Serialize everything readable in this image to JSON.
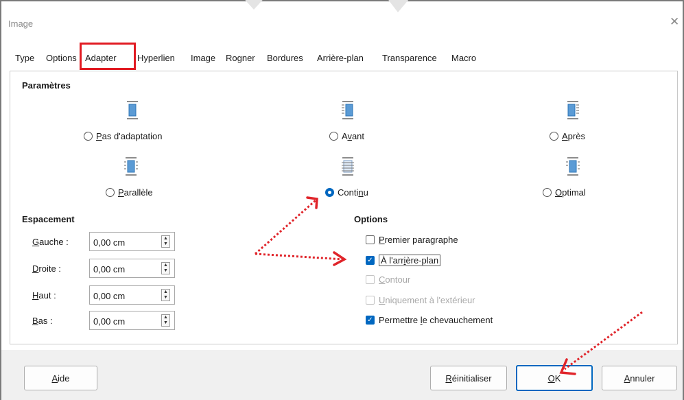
{
  "window": {
    "title": "Image",
    "close_glyph": "✕"
  },
  "tabs": [
    "Type",
    "Options",
    "Adapter",
    "Hyperlien",
    "Image",
    "Rogner",
    "Bordures",
    "Arrière-plan",
    "Transparence",
    "Macro"
  ],
  "active_tab": "Adapter",
  "parametres": {
    "title": "Paramètres",
    "options": [
      {
        "mnemonic": "P",
        "rest": "as d'adaptation",
        "checked": false,
        "icon": "wrap-none-icon"
      },
      {
        "mnemonic": "",
        "rest": "Avant",
        "pre": "A",
        "mn2": "v",
        "post": "ant",
        "checked": false,
        "icon": "wrap-before-icon"
      },
      {
        "mnemonic": "A",
        "rest": "près",
        "checked": false,
        "icon": "wrap-after-icon"
      },
      {
        "mnemonic": "P",
        "rest": "arallèle",
        "checked": false,
        "icon": "wrap-parallel-icon"
      },
      {
        "pre": "Conti",
        "mn2": "n",
        "post": "u",
        "checked": true,
        "icon": "wrap-through-icon"
      },
      {
        "mnemonic": "O",
        "rest": "ptimal",
        "checked": false,
        "icon": "wrap-optimal-icon"
      }
    ]
  },
  "espacement": {
    "title": "Espacement",
    "fields": [
      {
        "mnemonic": "G",
        "rest": "auche :",
        "value": "0,00 cm"
      },
      {
        "mnemonic": "D",
        "rest": "roite :",
        "value": "0,00 cm"
      },
      {
        "mnemonic": "H",
        "rest": "aut :",
        "value": "0,00 cm"
      },
      {
        "mnemonic": "B",
        "rest": "as :",
        "value": "0,00 cm"
      }
    ]
  },
  "options": {
    "title": "Options",
    "items": [
      {
        "mnemonic": "P",
        "rest": "remier paragraphe",
        "checked": false,
        "disabled": false
      },
      {
        "pre": "À l'arr",
        "mn2": "i",
        "post": "ère-plan",
        "checked": true,
        "disabled": false
      },
      {
        "mnemonic": "C",
        "rest": "ontour",
        "checked": false,
        "disabled": true
      },
      {
        "mnemonic": "U",
        "rest": "niquement à l'extérieur",
        "checked": false,
        "disabled": true
      },
      {
        "pre": "Permettre ",
        "mn2": "l",
        "post": "e chevauchement",
        "checked": true,
        "disabled": false
      }
    ]
  },
  "buttons": {
    "help": {
      "mnemonic": "A",
      "rest": "ide"
    },
    "reset": {
      "mnemonic": "R",
      "rest": "éinitialiser"
    },
    "ok": {
      "mnemonic": "O",
      "rest": "K"
    },
    "cancel": {
      "mnemonic": "A",
      "rest": "nnuler"
    }
  },
  "colors": {
    "accent": "#0067c0",
    "highlight": "#e11b22",
    "annotation": "#e0242a"
  }
}
